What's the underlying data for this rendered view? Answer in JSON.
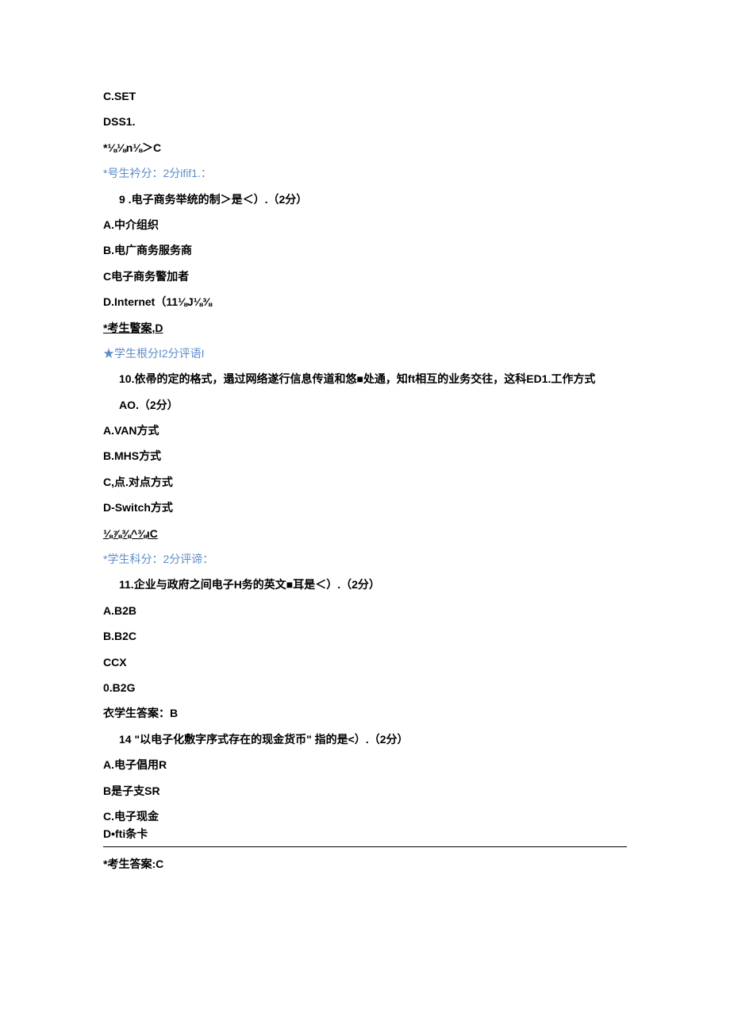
{
  "lines": {
    "l1": "C.SET",
    "l2": "DSS1.",
    "l3": "*⅛⅛n⅛＞C",
    "l4": "*号生衿分：2分ifif1.：",
    "l5": "9  .电子商务举统的制＞是＜）.（2分）",
    "l6": "A.中介组织",
    "l7": "B.电广商务服务商",
    "l8": "C电子商务警加者",
    "l9": "D.Internet（11⅛J⅛⅜",
    "l10": "*考生警案,D",
    "l11": "★学生根分I2分评语I",
    "l12": "10.依帚的定的格式，遢过网络遂行信息传道和悠■处通，知ft相互的业务交往，这科ED1.工作方式",
    "l13": "AO.（2分）",
    "l14": "A.VAN方式",
    "l15": "B.MHS方式",
    "l16": "C,点.对点方式",
    "l17": "D-Switch方式",
    "l18": "⅛⅞⅜^⅜ιC",
    "l19": "*学生科分：2分评谛：",
    "l20": "11.企业与政府之间电子H务的英文■耳是＜）.（2分）",
    "l21": "A.B2B",
    "l22": "B.B2C",
    "l23": "CCX",
    "l24": "0.B2G",
    "l25": "衣学生答案：B",
    "l26": "14 \"以电子化敷字序式存在的现金货币\" 指的是<）.（2分）",
    "l27": "A.电子倡用R",
    "l28": "B是子支SR",
    "l29": "C.电子现金",
    "l30": "D•fti条卡",
    "l31": "*考生答案:C"
  }
}
